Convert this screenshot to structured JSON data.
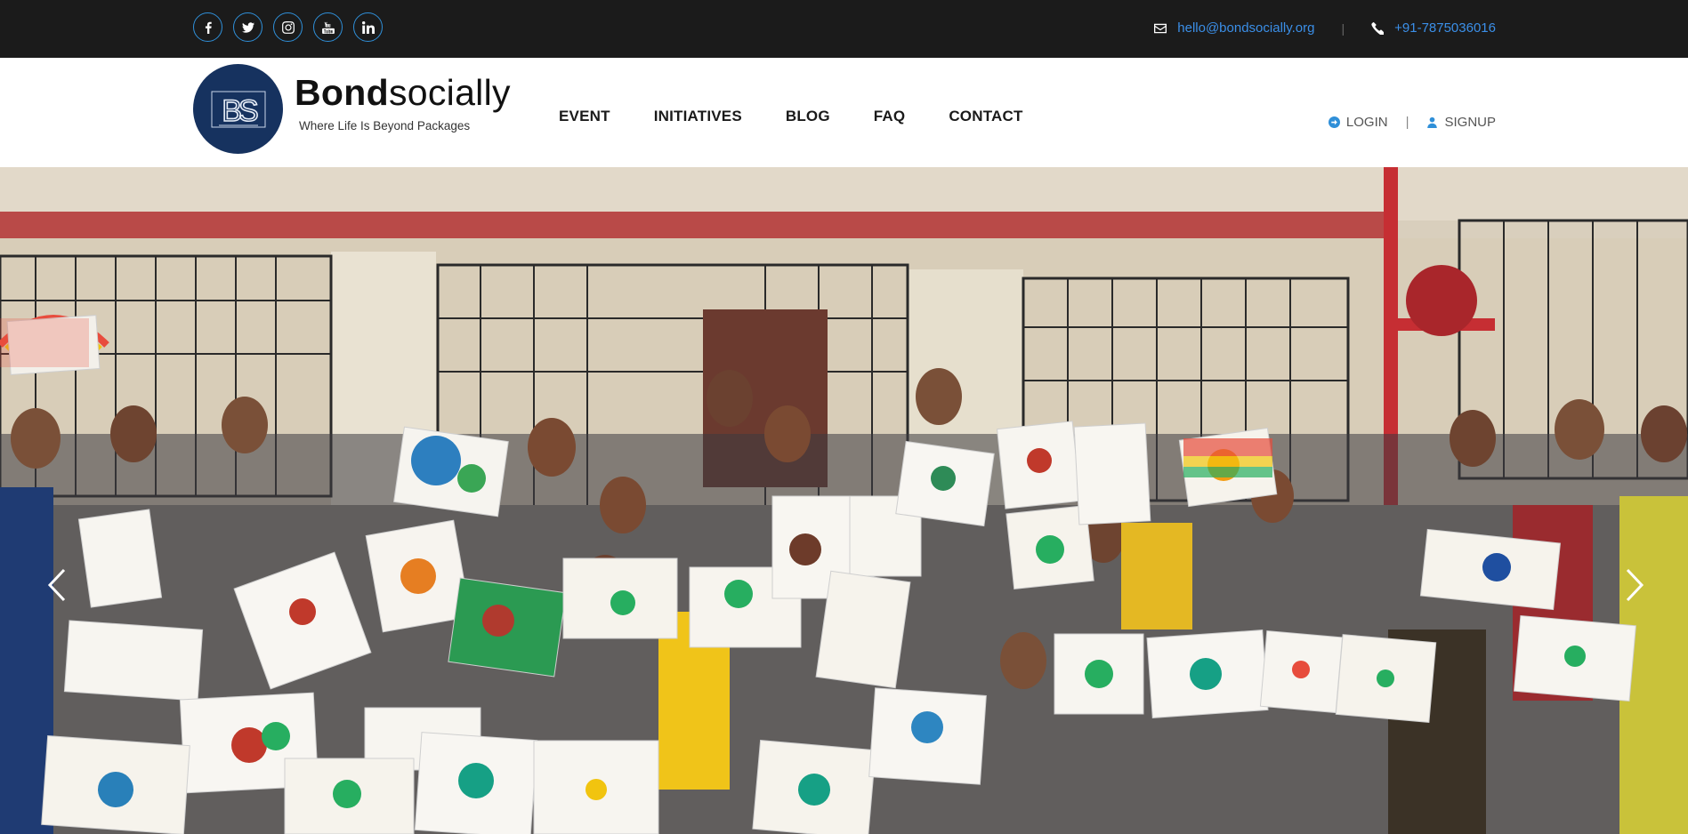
{
  "topbar": {
    "socials": [
      {
        "icon": "facebook-icon"
      },
      {
        "icon": "twitter-icon"
      },
      {
        "icon": "instagram-icon"
      },
      {
        "icon": "youtube-icon"
      },
      {
        "icon": "linkedin-icon"
      }
    ],
    "email": "hello@bondsocially.org",
    "phone": "+91-7875036016"
  },
  "header": {
    "logo_initials": "BS",
    "brand_bold": "Bond",
    "brand_light": "socially",
    "tagline": "Where Life Is Beyond Packages",
    "nav": [
      "EVENT",
      "INITIATIVES",
      "BLOG",
      "FAQ",
      "CONTACT"
    ],
    "login": "LOGIN",
    "signup": "SIGNUP"
  },
  "hero": {
    "prev_icon": "chevron-left-icon",
    "next_icon": "chevron-right-icon"
  },
  "colors": {
    "topbar_bg": "#1b1b1b",
    "accent": "#3b8fe8",
    "logo_bg": "#16325f"
  }
}
